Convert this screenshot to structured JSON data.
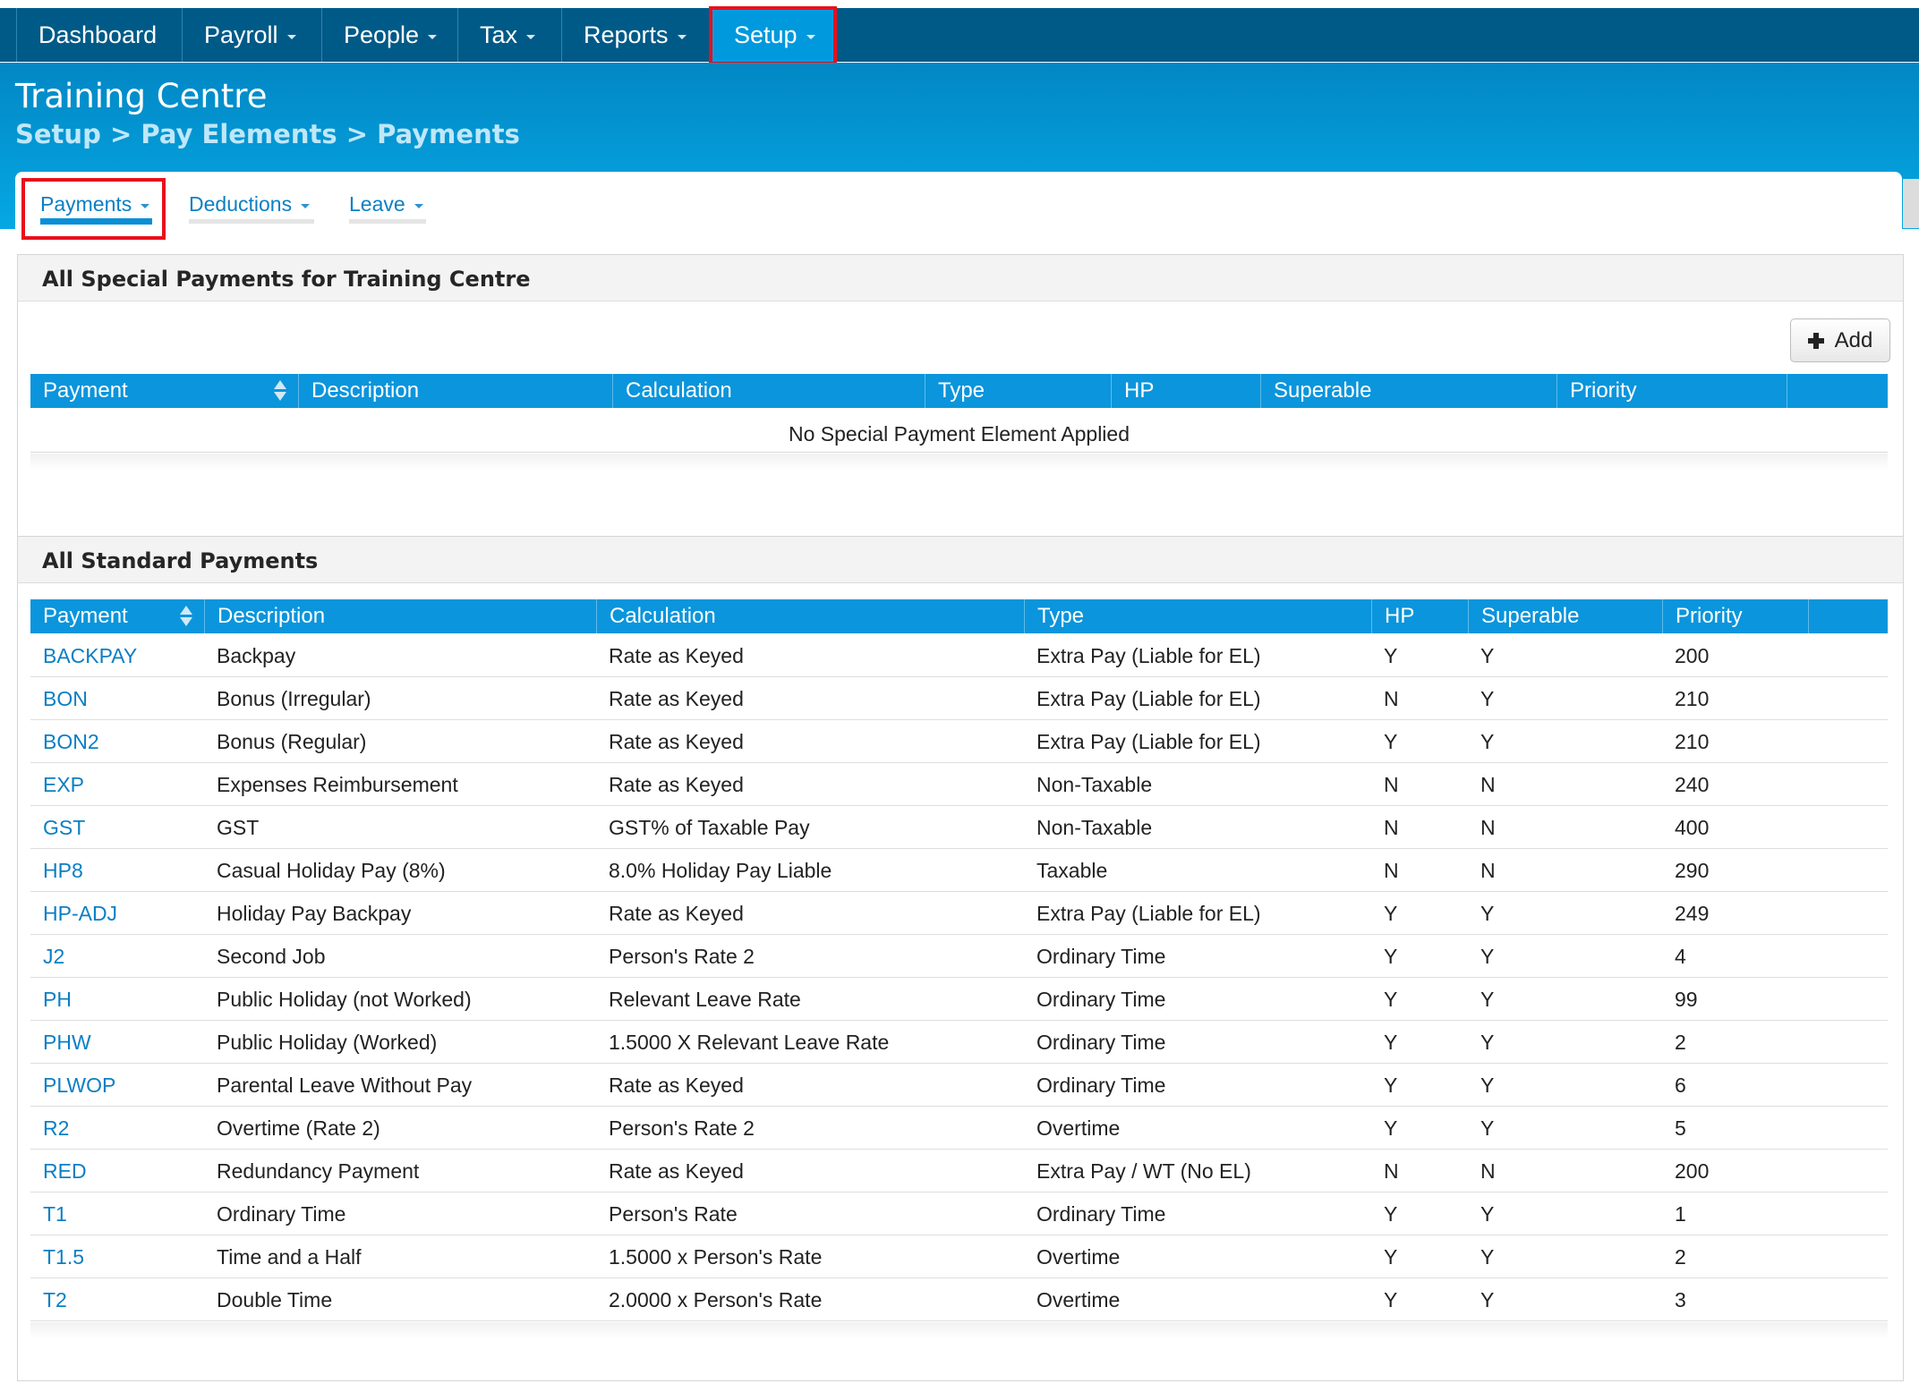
{
  "topnav": {
    "items": [
      {
        "label": "Dashboard",
        "dropdown": false
      },
      {
        "label": "Payroll",
        "dropdown": true
      },
      {
        "label": "People",
        "dropdown": true
      },
      {
        "label": "Tax",
        "dropdown": true
      },
      {
        "label": "Reports",
        "dropdown": true
      },
      {
        "label": "Setup",
        "dropdown": true,
        "active": true
      }
    ]
  },
  "header": {
    "title": "Training Centre",
    "breadcrumb": [
      "Setup",
      ">",
      "Pay Elements",
      ">",
      "Payments"
    ]
  },
  "subtabs": [
    {
      "label": "Payments",
      "active": true
    },
    {
      "label": "Deductions",
      "active": false
    },
    {
      "label": "Leave",
      "active": false
    }
  ],
  "special": {
    "title": "All Special Payments for Training Centre",
    "add_label": "Add",
    "columns": [
      "Payment",
      "Description",
      "Calculation",
      "Type",
      "HP",
      "Superable",
      "Priority",
      ""
    ],
    "empty_message": "No Special Payment Element Applied"
  },
  "standard": {
    "title": "All Standard Payments",
    "columns": [
      "Payment",
      "Description",
      "Calculation",
      "Type",
      "HP",
      "Superable",
      "Priority",
      ""
    ],
    "rows": [
      {
        "code": "BACKPAY",
        "description": "Backpay",
        "calculation": "Rate as Keyed",
        "type": "Extra Pay (Liable for EL)",
        "hp": "Y",
        "superable": "Y",
        "priority": "200"
      },
      {
        "code": "BON",
        "description": "Bonus (Irregular)",
        "calculation": "Rate as Keyed",
        "type": "Extra Pay (Liable for EL)",
        "hp": "N",
        "superable": "Y",
        "priority": "210"
      },
      {
        "code": "BON2",
        "description": "Bonus (Regular)",
        "calculation": "Rate as Keyed",
        "type": "Extra Pay (Liable for EL)",
        "hp": "Y",
        "superable": "Y",
        "priority": "210"
      },
      {
        "code": "EXP",
        "description": "Expenses Reimbursement",
        "calculation": "Rate as Keyed",
        "type": "Non-Taxable",
        "hp": "N",
        "superable": "N",
        "priority": "240"
      },
      {
        "code": "GST",
        "description": "GST",
        "calculation": "GST% of Taxable Pay",
        "type": "Non-Taxable",
        "hp": "N",
        "superable": "N",
        "priority": "400"
      },
      {
        "code": "HP8",
        "description": "Casual Holiday Pay (8%)",
        "calculation": "8.0% Holiday Pay Liable",
        "type": "Taxable",
        "hp": "N",
        "superable": "N",
        "priority": "290"
      },
      {
        "code": "HP-ADJ",
        "description": "Holiday Pay Backpay",
        "calculation": "Rate as Keyed",
        "type": "Extra Pay (Liable for EL)",
        "hp": "Y",
        "superable": "Y",
        "priority": "249"
      },
      {
        "code": "J2",
        "description": "Second Job",
        "calculation": "Person's Rate 2",
        "type": "Ordinary Time",
        "hp": "Y",
        "superable": "Y",
        "priority": "4"
      },
      {
        "code": "PH",
        "description": "Public Holiday (not Worked)",
        "calculation": "Relevant Leave Rate",
        "type": "Ordinary Time",
        "hp": "Y",
        "superable": "Y",
        "priority": "99"
      },
      {
        "code": "PHW",
        "description": "Public Holiday (Worked)",
        "calculation": "1.5000 X Relevant Leave Rate",
        "type": "Ordinary Time",
        "hp": "Y",
        "superable": "Y",
        "priority": "2"
      },
      {
        "code": "PLWOP",
        "description": "Parental Leave Without Pay",
        "calculation": "Rate as Keyed",
        "type": "Ordinary Time",
        "hp": "Y",
        "superable": "Y",
        "priority": "6"
      },
      {
        "code": "R2",
        "description": "Overtime (Rate 2)",
        "calculation": "Person's Rate 2",
        "type": "Overtime",
        "hp": "Y",
        "superable": "Y",
        "priority": "5"
      },
      {
        "code": "RED",
        "description": "Redundancy Payment",
        "calculation": "Rate as Keyed",
        "type": "Extra Pay / WT (No EL)",
        "hp": "N",
        "superable": "N",
        "priority": "200"
      },
      {
        "code": "T1",
        "description": "Ordinary Time",
        "calculation": "Person's Rate",
        "type": "Ordinary Time",
        "hp": "Y",
        "superable": "Y",
        "priority": "1"
      },
      {
        "code": "T1.5",
        "description": "Time and a Half",
        "calculation": "1.5000 x Person's Rate",
        "type": "Overtime",
        "hp": "Y",
        "superable": "Y",
        "priority": "2"
      },
      {
        "code": "T2",
        "description": "Double Time",
        "calculation": "2.0000 x Person's Rate",
        "type": "Overtime",
        "hp": "Y",
        "superable": "Y",
        "priority": "3"
      }
    ]
  },
  "colors": {
    "topnav": "#005a87",
    "active_tab": "#0099dd",
    "table_header": "#0b95dc",
    "link": "#0a7fc4",
    "highlight": "#e8101c"
  }
}
